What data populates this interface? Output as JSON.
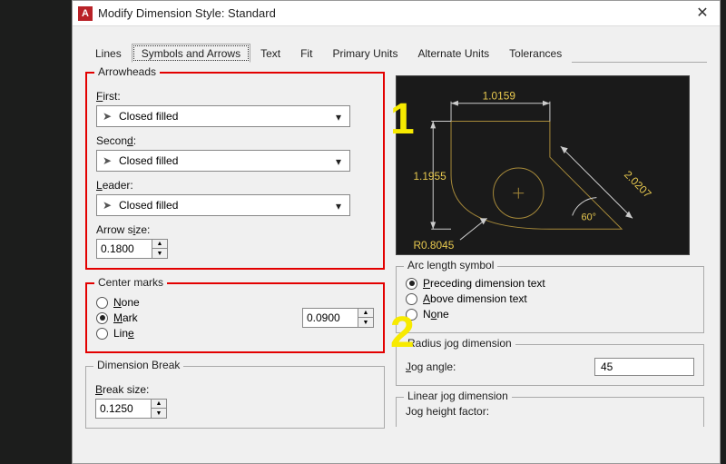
{
  "window": {
    "title": "Modify Dimension Style: Standard"
  },
  "tabs": {
    "lines": "Lines",
    "symbols": "Symbols and Arrows",
    "text": "Text",
    "fit": "Fit",
    "primary": "Primary Units",
    "alternate": "Alternate Units",
    "tolerances": "Tolerances"
  },
  "arrowheads": {
    "title": "Arrowheads",
    "first_label": "First:",
    "first_value": "Closed filled",
    "second_label": "Second:",
    "second_value": "Closed filled",
    "leader_label": "Leader:",
    "leader_value": "Closed filled",
    "arrow_size_label": "Arrow size:",
    "arrow_size_value": "0.1800"
  },
  "center_marks": {
    "title": "Center marks",
    "none": "None",
    "mark": "Mark",
    "line": "Line",
    "size": "0.0900"
  },
  "dim_break": {
    "title": "Dimension Break",
    "break_size_label": "Break size:",
    "break_size_value": "0.1250"
  },
  "preview": {
    "dim_top": "1.0159",
    "dim_left": "1.1955",
    "dim_diag": "2.0207",
    "dim_angle": "60°",
    "dim_radius": "R0.8045"
  },
  "arc": {
    "title": "Arc length symbol",
    "preceding": "Preceding dimension text",
    "above": "Above dimension text",
    "none": "None"
  },
  "jog_radius": {
    "title": "Radius jog dimension",
    "angle_label": "Jog angle:",
    "angle_value": "45"
  },
  "jog_linear": {
    "title": "Linear jog dimension",
    "factor_label": "Jog height factor:"
  },
  "annotations": {
    "one": "1",
    "two": "2"
  }
}
